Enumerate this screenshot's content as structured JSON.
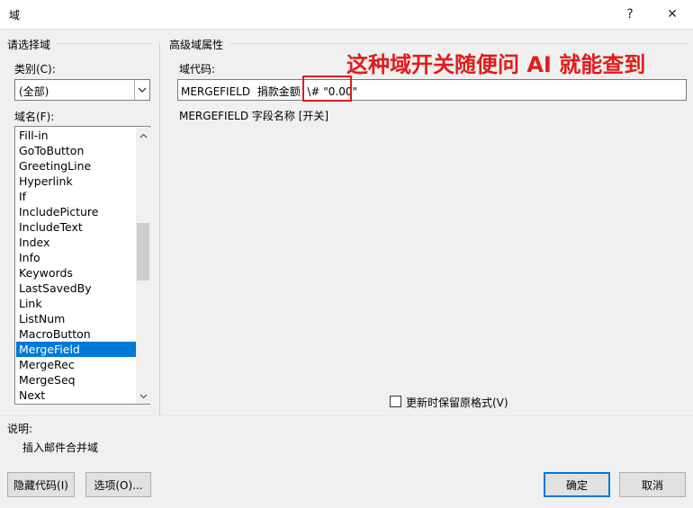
{
  "window": {
    "title": "域",
    "help_symbol": "?",
    "close_symbol": "✕"
  },
  "left": {
    "group_label": "请选择域",
    "category_label": "类别(C):",
    "category_value": "(全部)",
    "fieldname_label": "域名(F):",
    "fields": [
      "Fill-in",
      "GoToButton",
      "GreetingLine",
      "Hyperlink",
      "If",
      "IncludePicture",
      "IncludeText",
      "Index",
      "Info",
      "Keywords",
      "LastSavedBy",
      "Link",
      "ListNum",
      "MacroButton",
      "MergeField",
      "MergeRec",
      "MergeSeq",
      "Next"
    ],
    "selected_field": "MergeField"
  },
  "right": {
    "group_label": "高级域属性",
    "code_label": "域代码:",
    "code_value": "MERGEFIELD  捐款金额  \\# \"0.00\"",
    "code_syntax": "MERGEFIELD 字段名称 [开关]",
    "preserve_format_label": "更新时保留原格式(V)",
    "preserve_format_checked": false
  },
  "annotation": "这种域开关随便问 AI 就能查到",
  "description": {
    "label": "说明:",
    "text": "插入邮件合并域"
  },
  "buttons": {
    "hide_codes": "隐藏代码(I)",
    "options": "选项(O)...",
    "ok": "确定",
    "cancel": "取消"
  },
  "icons": {
    "dropdown": "chevron-down-icon",
    "scroll_up": "chevron-up-icon",
    "scroll_down": "chevron-down-icon"
  },
  "colors": {
    "selection": "#0078d7",
    "annotation": "#e31b1b"
  }
}
